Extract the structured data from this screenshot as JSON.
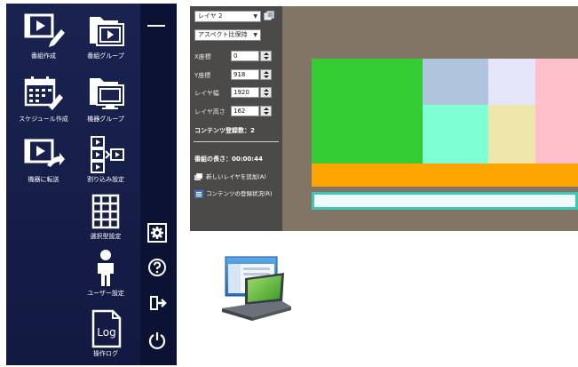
{
  "menu": {
    "items": [
      {
        "label": "番組作成",
        "icon": "video-edit-icon"
      },
      {
        "label": "番組グループ",
        "icon": "program-group-icon"
      },
      {
        "label": "スケジュール作成",
        "icon": "calendar-edit-icon"
      },
      {
        "label": "機器グループ",
        "icon": "device-group-icon"
      },
      {
        "label": "機器に転送",
        "icon": "send-to-device-icon"
      },
      {
        "label": "割り込み設定",
        "icon": "interrupt-icon"
      },
      {
        "label": "選択型設定",
        "icon": "grid-icon"
      },
      {
        "label": "ユーザー設定",
        "icon": "user-icon"
      },
      {
        "label": "操作ログ",
        "icon": "log-icon"
      }
    ],
    "log_icon_text": "Log"
  },
  "side": {
    "buttons": [
      "settings-icon",
      "help-icon",
      "logout-icon",
      "power-icon"
    ]
  },
  "editor": {
    "layer_select": "レイヤ 2",
    "aspect_select": "アスペクト比保持",
    "fields": {
      "x": {
        "label": "X座標",
        "value": "0"
      },
      "y": {
        "label": "Y座標",
        "value": "918"
      },
      "w": {
        "label": "レイヤ幅",
        "value": "1920"
      },
      "h": {
        "label": "レイヤ高さ",
        "value": "162"
      }
    },
    "content_count": "コンテンツ登録数：2",
    "duration": "番組の長さ：00:00:44",
    "add_layer": "新しいレイヤを追加(A)",
    "content_status": "コンテンツの登録状況(R)"
  },
  "colors": {
    "menu_bg": "#1a2250",
    "panel_bg": "#4c4a48",
    "canvas_bg": "#817566",
    "cell_green": "#33cc33",
    "cell_blue": "#b0c4de",
    "cell_lavender": "#e6e6fa",
    "cell_pink": "#ffc0cb",
    "cell_aquamarine": "#7fffd4",
    "cell_khaki": "#eee6aa",
    "orange_bar": "#ffa500",
    "selected_layer_border": "#3cc8b4"
  },
  "desktop_icon": "laptop-window-icon"
}
